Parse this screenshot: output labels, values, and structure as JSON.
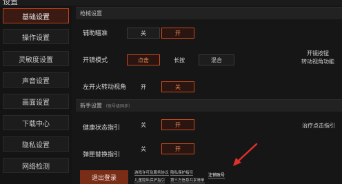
{
  "window": {
    "title": "设置"
  },
  "sidebar": {
    "items": [
      {
        "label": "基础设置",
        "active": true
      },
      {
        "label": "操作设置",
        "active": false
      },
      {
        "label": "灵敏度设置",
        "active": false
      },
      {
        "label": "声音设置",
        "active": false
      },
      {
        "label": "画面设置",
        "active": false
      },
      {
        "label": "下载中心",
        "active": false
      },
      {
        "label": "隐私设置",
        "active": false
      },
      {
        "label": "网络检测",
        "active": false
      }
    ]
  },
  "sections": {
    "weapon": {
      "title": "枪械设置"
    },
    "novice": {
      "title": "新手设置",
      "note": "（账号级同步）"
    }
  },
  "settings": {
    "aim_assist": {
      "label": "辅助瞄准",
      "options": [
        "关",
        "开"
      ],
      "selected": "开"
    },
    "scope_mode": {
      "label": "开镜模式",
      "options": [
        "点击",
        "长按",
        "混合"
      ],
      "selected": "点击"
    },
    "left_fire_view": {
      "label": "左开火转动视角",
      "options": [
        "开",
        "关"
      ],
      "selected": "关"
    },
    "health_hint": {
      "label": "健康状态指引",
      "options": [
        "关",
        "开"
      ],
      "selected": "开"
    },
    "reload_hint": {
      "label": "弹匣替换指引",
      "options": [
        "关",
        "开"
      ],
      "selected": "开"
    }
  },
  "notes": {
    "scope_note_line1": "开镜按钮",
    "scope_note_line2": "转动视角功能",
    "heal_note": "治疗点击指引"
  },
  "footer": {
    "logout_label": "退出登录",
    "links": [
      "游戏许可及服务协议",
      "隐私保护指引",
      "儿童隐私保护指引",
      "第三方信息共享清单",
      "注销账号"
    ]
  },
  "colors": {
    "accent": "#c94a1e",
    "background": "#161616"
  }
}
